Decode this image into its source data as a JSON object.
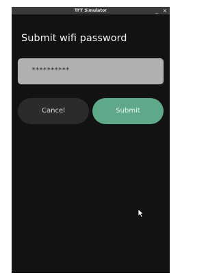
{
  "window": {
    "title": "TFT Simulator",
    "minimize_label": "_",
    "close_label": "×"
  },
  "screen": {
    "heading": "Submit wifi password",
    "password_value": "**********",
    "cancel_label": "Cancel",
    "submit_label": "Submit"
  },
  "colors": {
    "background": "#121212",
    "field": "#b0b0b3",
    "cancel": "#2a2b2a",
    "submit": "#5fa889"
  }
}
